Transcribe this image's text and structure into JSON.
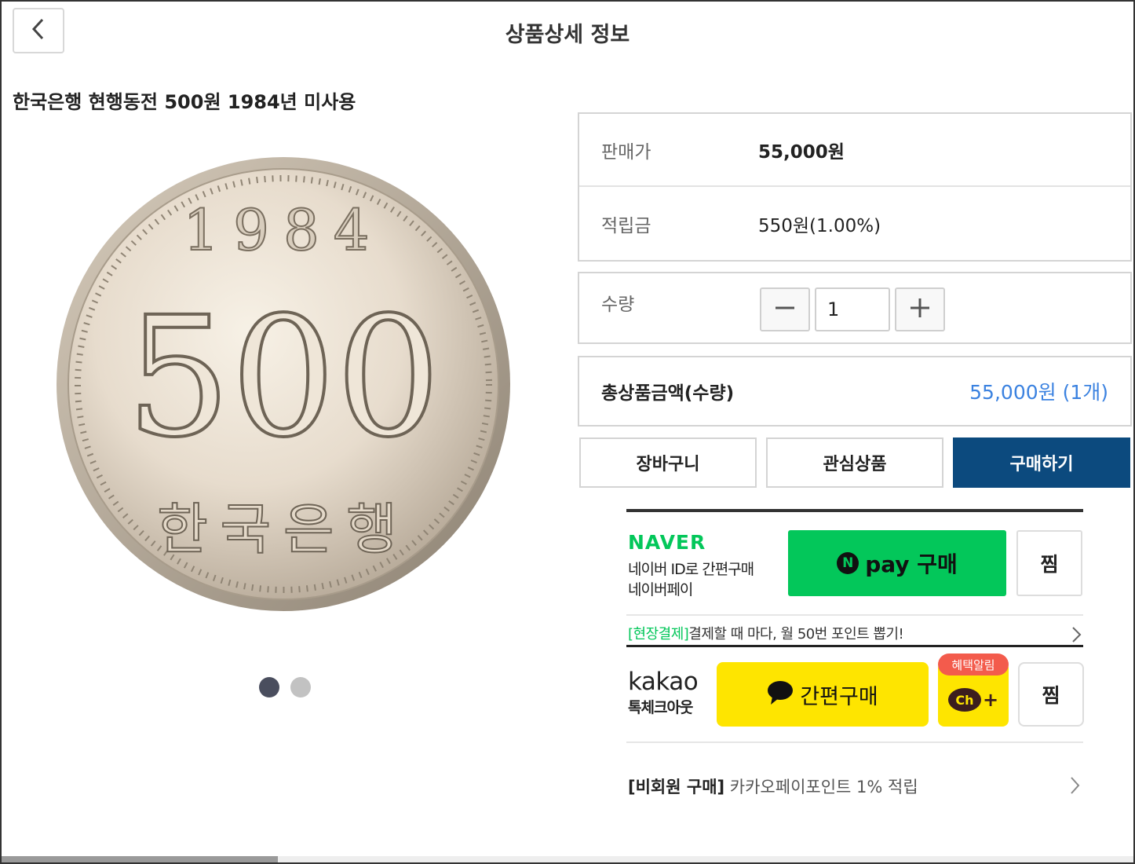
{
  "header": {
    "title": "상품상세 정보"
  },
  "product": {
    "name": "한국은행 현행동전 500원 1984년 미사용",
    "coin_year": "1984",
    "coin_value": "500",
    "coin_issuer": "한국은행"
  },
  "gallery": {
    "slide_count": 2,
    "active_index": 0
  },
  "info": {
    "price_label": "판매가",
    "price_value": "55,000원",
    "points_label": "적립금",
    "points_value": "550원(1.00%)"
  },
  "quantity": {
    "label": "수량",
    "value": "1"
  },
  "total": {
    "label": "총상품금액(수량)",
    "value": "55,000원 (1개)"
  },
  "actions": {
    "cart": "장바구니",
    "wishlist": "관심상품",
    "buy": "구매하기"
  },
  "naver": {
    "logo": "NAVER",
    "sub1": "네이버 ID로 간편구매",
    "sub2": "네이버페이",
    "pay_n": "N",
    "pay_label": "pay 구매",
    "jjim": "찜",
    "promo_tag": "[현장결제]",
    "promo_text": "결제할 때 마다, 월 50번 포인트 뽑기!"
  },
  "kakao": {
    "logo": "kakao",
    "sub": "톡체크아웃",
    "buy_label": "간편구매",
    "ch_badge": "혜택알림",
    "ch_label": "Ch",
    "ch_plus": "+",
    "jjim": "찜",
    "promo_tag": "[비회원 구매]",
    "promo_text": "카카오페이포인트 1% 적립"
  },
  "colors": {
    "primary": "#0c4a7e",
    "total_value": "#3b82e0",
    "naver_green": "#03c75a",
    "kakao_yellow": "#fee500",
    "badge_red": "#f35b4c"
  },
  "icons": {
    "back": "chevron-left-icon",
    "minus": "minus-icon",
    "plus": "plus-icon",
    "promo_arrow": "chevron-right-icon",
    "speech": "speech-bubble-icon"
  }
}
